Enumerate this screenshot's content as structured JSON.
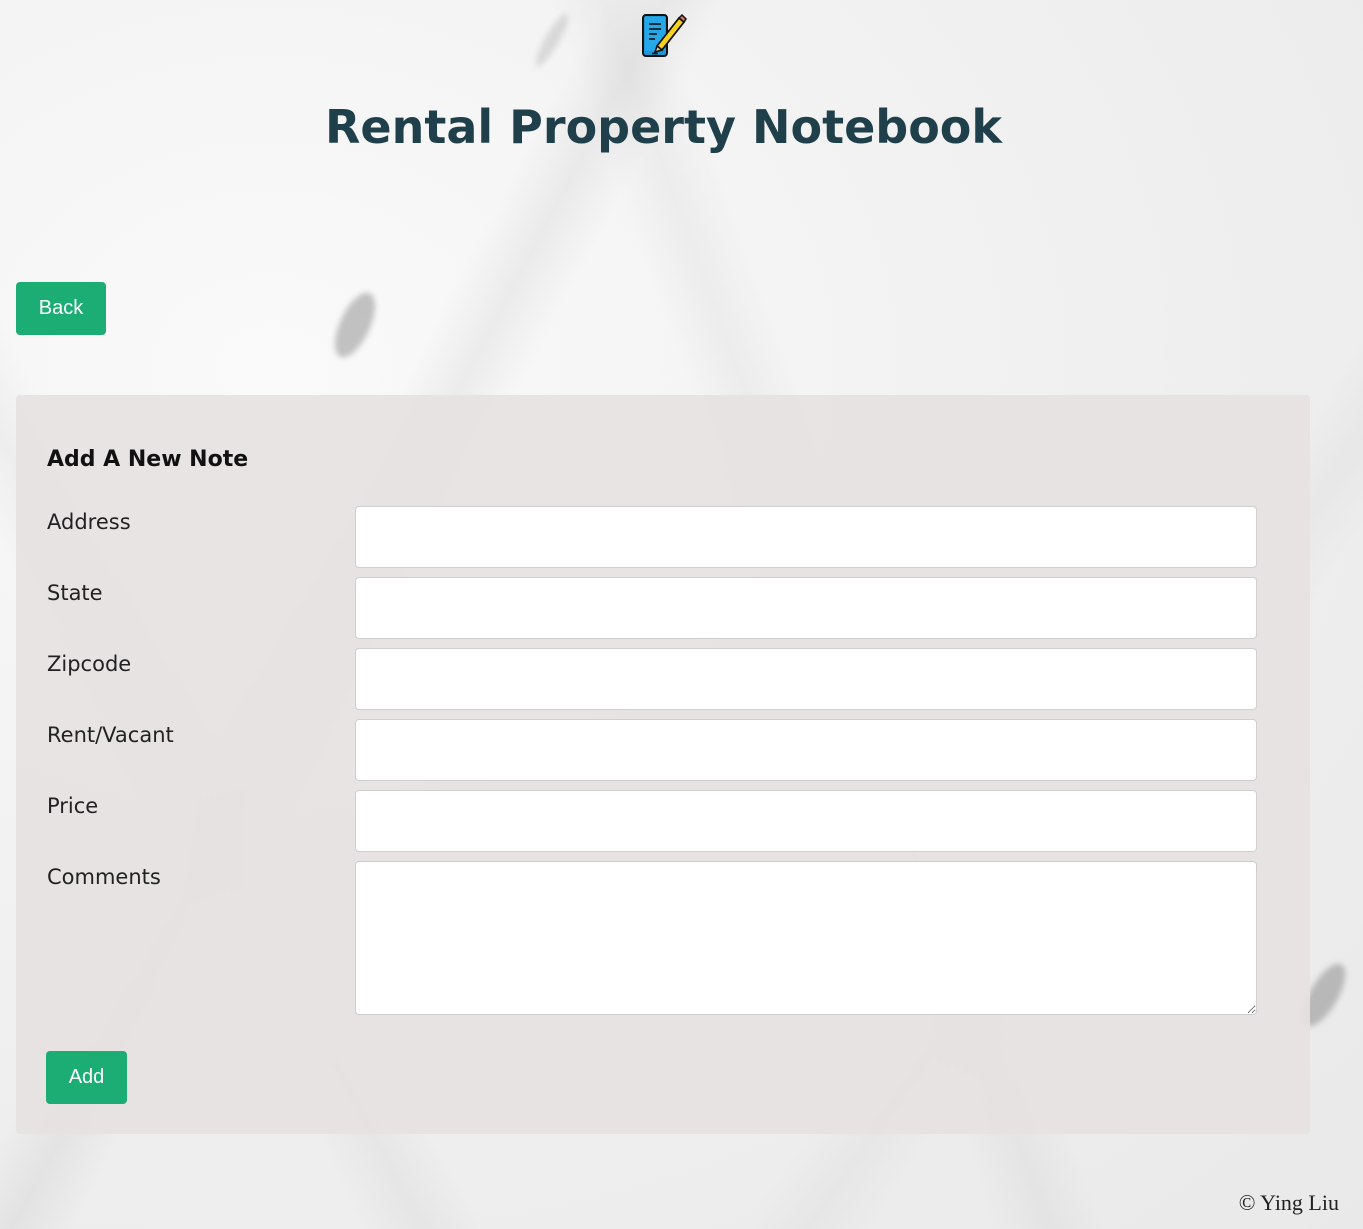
{
  "header": {
    "logo_icon": "memo-phone-pencil-icon",
    "title": "Rental Property Notebook"
  },
  "nav": {
    "back_label": "Back"
  },
  "form": {
    "heading": "Add A New Note",
    "fields": [
      {
        "label": "Address",
        "value": "",
        "type": "input"
      },
      {
        "label": "State",
        "value": "",
        "type": "input"
      },
      {
        "label": "Zipcode",
        "value": "",
        "type": "input"
      },
      {
        "label": "Rent/Vacant",
        "value": "",
        "type": "input"
      },
      {
        "label": "Price",
        "value": "",
        "type": "input"
      },
      {
        "label": "Comments",
        "value": "",
        "type": "textarea"
      }
    ],
    "submit_label": "Add"
  },
  "footer": {
    "copyright": "© Ying Liu"
  },
  "colors": {
    "accent": "#1bad74",
    "title": "#1f3f4a",
    "panel": "#e6e2e2"
  }
}
